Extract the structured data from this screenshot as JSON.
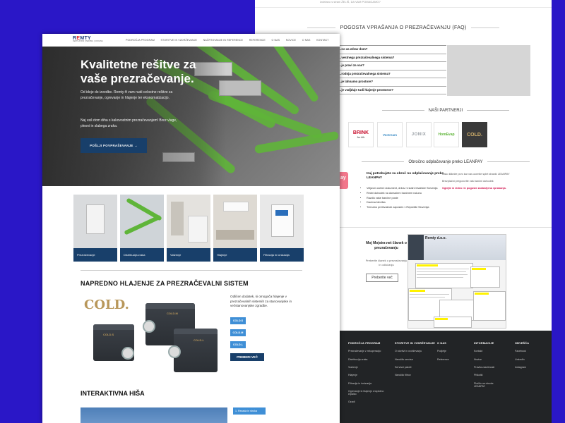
{
  "back_page": {
    "top_note": "Izdelano s strani ŽELIŠ, DA VAM POMAGAMO?",
    "faq": {
      "title": "POGOSTA VPRAŠANJA O PREZRAČEVANJU (FAQ)",
      "items": [
        "…no za zdrav dom?",
        "…vestnega prezračevalnega sistema?",
        "…je pravi za vas?",
        "…rodnja prezračevalnega sistema?",
        "…je lahnamo prostore?",
        "…je vzdjduje tudi hlajenje prostorov?"
      ]
    },
    "partners": {
      "title": "NAŠI PARTNERJI",
      "items": [
        {
          "name": "BRINK",
          "sub": "for life",
          "color": "#c8102e"
        },
        {
          "name": "Vectream",
          "sub": "",
          "color": "#3b8cc5"
        },
        {
          "name": "JONIX",
          "sub": "",
          "color": "#9aa0a6"
        },
        {
          "name": "HomEvap",
          "sub": "",
          "color": "#5fb539"
        },
        {
          "name": "COLD.",
          "sub": "",
          "color": "#d1b06b"
        }
      ]
    },
    "leanpay": {
      "title": "Obročno odplačevanje preko LEANPAY",
      "badge": "ay",
      "heading": "Kaj potrebujete za obroč no odplačevanje preko LEANPAY",
      "list": [
        "Veljavni osebni dokument, držav ni stalni bivališče Slovenija",
        "Redni dohodek na domačem bančnem računu",
        "Razdlo vaše bančne poste",
        "Davčna številka",
        "Trenutno prebivalecki zaposlen v Republiki Slovenija"
      ],
      "side_1": "Kako kliknite prvo kar vas ocenite splet stranki LEANPAY",
      "side_2": "Brezplačni pregovorite vaš bančni dohodek",
      "side_3": "Oglejte si video: in pogoste zastavljena vprašanja."
    },
    "promo": {
      "text": "Moj Mojster.net članek o prezračevanju",
      "sub": "Preberite članek o prezračevanju in odločanju",
      "button": "Preberite več",
      "shot_title": "Remty d.o.o."
    },
    "footer": {
      "columns": [
        {
          "heading": "PODROČJA PROGRAM",
          "items": [
            "Prezračevanje z rekuperacijo",
            "Distribucija zraka",
            "Vlaženje",
            "Hlajenje",
            "Filtracija in ionizacija",
            "Ogrevanje in hlajenje s toplotno črpalko",
            "Ozadi"
          ]
        },
        {
          "heading": "STORITVE IN VZDRŽEVANJE",
          "items": [
            "O storitvi in vzdrževanju",
            "Naročilo servisa",
            "Servisni paketi",
            "Naročilo filtrov"
          ]
        },
        {
          "heading": "O NAS",
          "items": [
            "Podjetje",
            "Reference"
          ]
        },
        {
          "heading": "INFORMACIJE",
          "items": [
            "Kontakt",
            "Novice",
            "Pravila zasebnosti",
            "Piškotki",
            "Plačilo na obroke LEANPAY"
          ]
        },
        {
          "heading": "OBVEŠČA",
          "items": [
            "Facebook",
            "LinkedIn",
            "Instagram"
          ]
        }
      ]
    }
  },
  "front_page": {
    "logo": {
      "prefix": "R",
      "accent": "E",
      "suffix": "MTY",
      "tagline": "VENTILATION | HEATING | COOLING"
    },
    "nav": [
      "PODROČJA PROGRAM",
      "STORITVE IN VZDRŽEVANJE",
      "NAČRTOVANJE IN REFERENCE",
      "REFERENCE",
      "O NAS",
      "NOVICE",
      "O NAS",
      "KONTAKT"
    ],
    "hero": {
      "title": "Kvalitetne rešitve za vaše prezračevanje.",
      "p1": "Od ideje do izvedbe. Remty-ft vam nudi celostne rešitve za prezračevanje, ogrevanje in hlajenje ter ekonomatizacijo.",
      "p2": "Naj vaš dom diha s kakovostnim prezračevanjem! Brez vlage, plesni in slabega zraka.",
      "button": "POŠLJI POVPRAŠEVANJE →"
    },
    "categories": [
      {
        "label": "Prezračevanje",
        "bg": "#d9dbdd"
      },
      {
        "label": "Distribucija zraka",
        "bg": "#cfd4d8"
      },
      {
        "label": "Vlaženje",
        "bg": "#e4e2de"
      },
      {
        "label": "Hlajenje",
        "bg": "#dedad3"
      },
      {
        "label": "Filtracija in ionizacija",
        "bg": "#e8e8e8"
      }
    ],
    "cold_section": {
      "title": "NAPREDNO HLAJENJE ZA PREZRAČEVALNI SISTEM",
      "logo": "COLD.",
      "description": "Odličen dodatek, ki omogoča hlajenje v prezračevalnih sistemih za stanovanjske in večstanovanjske zgradbe.",
      "options": [
        "COLD.S",
        "COLD.M",
        "COLD.L"
      ],
      "unit_labels": [
        "COLD.M",
        "COLD.S",
        "COLD.L"
      ],
      "button": "PREBERI VEČ"
    },
    "house_section": {
      "title": "INTERAKTIVNA HIŠA",
      "step": "1. Rezada in stroka"
    }
  }
}
